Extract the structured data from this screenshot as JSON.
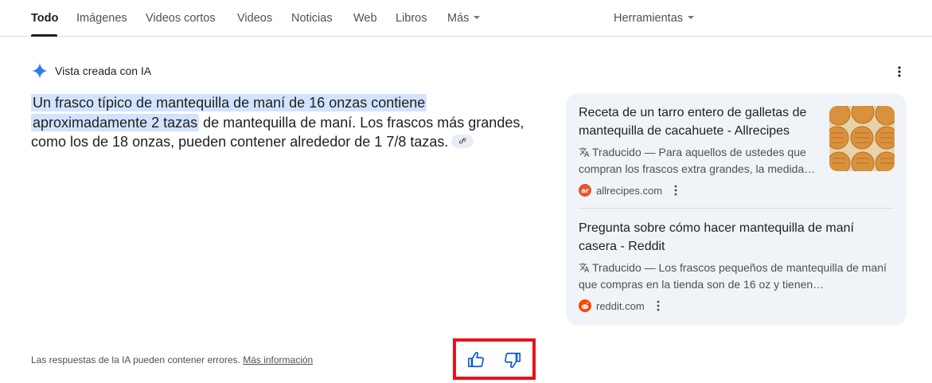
{
  "nav": {
    "tabs": [
      {
        "label": "Todo",
        "active": true
      },
      {
        "label": "Imágenes"
      },
      {
        "label": "Videos cortos"
      },
      {
        "label": "Videos"
      },
      {
        "label": "Noticias"
      },
      {
        "label": "Web"
      },
      {
        "label": "Libros"
      },
      {
        "label": "Más"
      }
    ],
    "tools": "Herramientas"
  },
  "ai": {
    "header": "Vista creada con IA",
    "answer": {
      "highlight_1": "Un frasco típico de mantequilla de maní de 16 onzas contiene",
      "highlight_2": "aproximadamente 2 tazas",
      "rest": " de mantequilla de maní. Los frascos más grandes, como los de 18 onzas, pueden contener alrededor de 1 7/8 tazas."
    },
    "disclaimer": "Las respuestas de la IA pueden contener errores.",
    "more_info": "Más información"
  },
  "sources": [
    {
      "title": "Receta de un tarro entero de galletas de mantequilla de cacahuete - Allrecipes",
      "snippet": "Traducido — Para aquellos de ustedes que compran los frascos extra grandes, la medida…",
      "domain": "allrecipes.com",
      "favicon_text": "ar",
      "favicon_color": "#e8542f"
    },
    {
      "title": "Pregunta sobre cómo hacer mantequilla de maní casera - Reddit",
      "snippet": "Traducido — Los frascos pequeños de mantequilla de maní que compras en la tienda son de 16 oz y tienen…",
      "domain": "reddit.com",
      "favicon_color": "#ff4500"
    }
  ],
  "colors": {
    "highlight": "#d3e3fd",
    "card_bg": "#f0f4f9",
    "feedback_icon": "#0b57d0",
    "annotation_box": "#e8121a"
  }
}
